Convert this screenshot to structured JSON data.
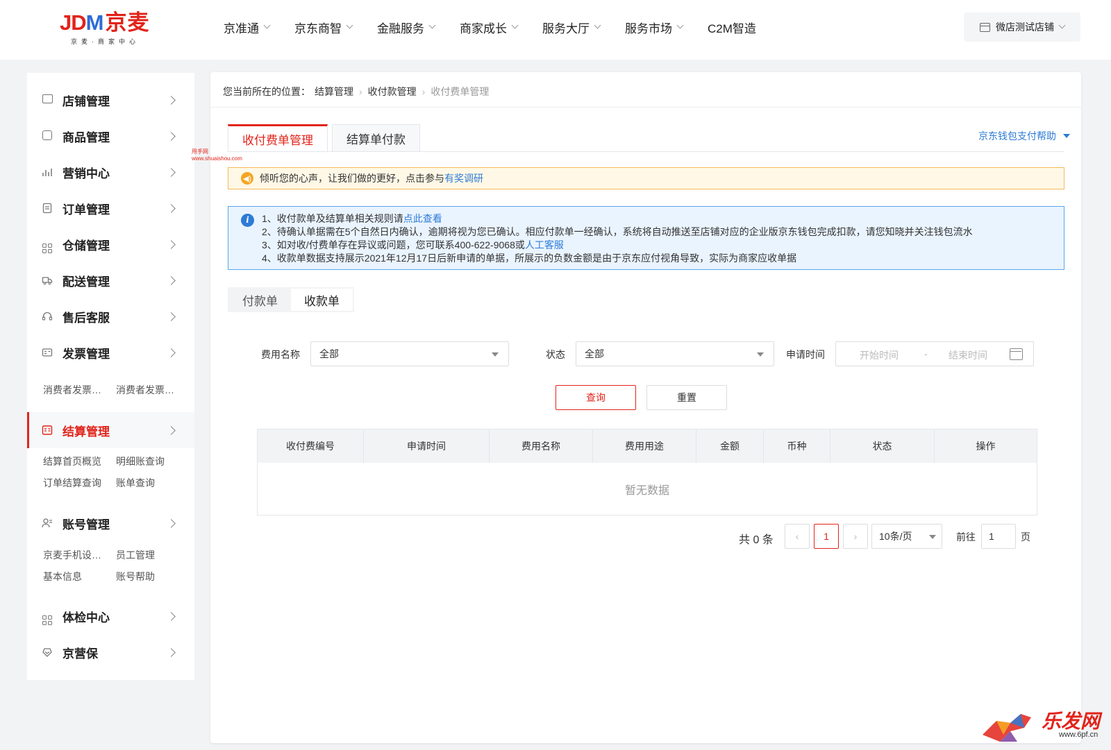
{
  "header": {
    "logo_main_jd": "JD",
    "logo_main_m": "M",
    "logo_cn": "京麦",
    "logo_sub": "京麦·商家中心",
    "nav": [
      {
        "label": "京准通",
        "has_dropdown": true
      },
      {
        "label": "京东商智",
        "has_dropdown": true
      },
      {
        "label": "金融服务",
        "has_dropdown": true
      },
      {
        "label": "商家成长",
        "has_dropdown": true
      },
      {
        "label": "服务大厅",
        "has_dropdown": true
      },
      {
        "label": "服务市场",
        "has_dropdown": true
      },
      {
        "label": "C2M智造",
        "has_dropdown": false
      }
    ],
    "store": "微店测试店铺"
  },
  "sidebar": {
    "items": [
      {
        "label": "店铺管理",
        "icon": "store-icon"
      },
      {
        "label": "商品管理",
        "icon": "bag-icon"
      },
      {
        "label": "营销中心",
        "icon": "chart-icon"
      },
      {
        "label": "订单管理",
        "icon": "order-icon"
      },
      {
        "label": "仓储管理",
        "icon": "grid-icon"
      },
      {
        "label": "配送管理",
        "icon": "truck-icon"
      },
      {
        "label": "售后客服",
        "icon": "headset-icon"
      },
      {
        "label": "发票管理",
        "icon": "invoice-icon"
      },
      {
        "label": "结算管理",
        "icon": "settlement-icon",
        "active": true
      },
      {
        "label": "账号管理",
        "icon": "user-icon"
      },
      {
        "label": "体检中心",
        "icon": "grid-icon"
      },
      {
        "label": "京营保",
        "icon": "shield-icon"
      }
    ],
    "invoice_sub": [
      "消费者发票…",
      "消费者发票…"
    ],
    "settlement_sub": [
      "结算首页概览",
      "明细账查询",
      "订单结算查询",
      "账单查询"
    ],
    "account_sub": [
      "京麦手机设…",
      "员工管理",
      "基本信息",
      "账号帮助"
    ]
  },
  "main": {
    "breadcrumb": {
      "prefix": "您当前所在的位置：",
      "level1": "结算管理",
      "level2": "收付款管理",
      "current": "收付费单管理"
    },
    "tabs": [
      "收付费单管理",
      "结算单付款"
    ],
    "help_link": "京东钱包支付帮助",
    "watermark_line1": "甩手网",
    "watermark_line2": "www.shuaishou.com",
    "notice": {
      "text": "倾听您的心声，让我们做的更好，点击参与",
      "link": "有奖调研"
    },
    "info": {
      "line1_text": "1、收付款单及结算单相关规则请",
      "line1_link": "点此查看",
      "line2": "2、待确认单据需在5个自然日内确认，逾期将视为您已确认。相应付款单一经确认，系统将自动推送至店铺对应的企业版京东钱包完成扣款，请您知晓并关注钱包流水",
      "line3_text": "3、如对收/付费单存在异议或问题，您可联系400-622-9068或",
      "line3_link": "人工客服",
      "line4": "4、收款单数据支持展示2021年12月17日后新申请的单据，所展示的负数金额是由于京东应付视角导致，实际为商家应收单据"
    },
    "subtabs": [
      "付款单",
      "收款单"
    ],
    "filters": {
      "fee_label": "费用名称",
      "fee_value": "全部",
      "status_label": "状态",
      "status_value": "全部",
      "time_label": "申请时间",
      "start_placeholder": "开始时间",
      "range_sep": "-",
      "end_placeholder": "结束时间"
    },
    "buttons": {
      "query": "查询",
      "reset": "重置"
    },
    "table": {
      "columns": [
        "收付费编号",
        "申请时间",
        "费用名称",
        "费用用途",
        "金额",
        "币种",
        "状态",
        "操作"
      ],
      "empty_text": "暂无数据"
    },
    "pagination": {
      "total": "共 0 条",
      "current_page": "1",
      "page_size": "10条/页",
      "goto_label": "前往",
      "goto_value": "1",
      "page_suffix": "页"
    }
  },
  "corner_brand": {
    "text": "乐发网",
    "url": "www.6pf.cn"
  },
  "colors": {
    "accent_red": "#e2231a",
    "link_blue": "#2d7bd6",
    "notice_bg": "#fff8e6",
    "info_bg": "#eaf4ff"
  }
}
